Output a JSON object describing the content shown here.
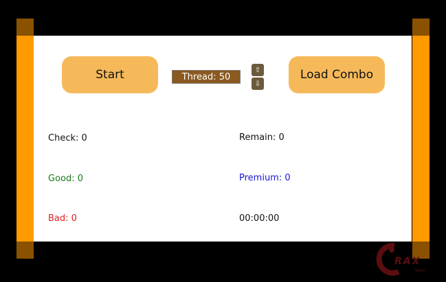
{
  "controls": {
    "start_label": "Start",
    "load_label": "Load Combo",
    "thread_label": "Thread:",
    "thread_value": "50",
    "spin_up": "⇧",
    "spin_down": "⇩"
  },
  "stats": {
    "check": "Check: 0",
    "remain": "Remain: 0",
    "good": "Good: 0",
    "premium": "Premium: 0",
    "bad": "Bad: 0",
    "timer": "00:00:00"
  },
  "logo": {
    "text": "RAX",
    "sub": "Team"
  },
  "colors": {
    "accent": "#ff9a00",
    "button": "#f6b95a",
    "good": "#1a7a1a",
    "premium": "#1818d8",
    "bad": "#e02020"
  }
}
